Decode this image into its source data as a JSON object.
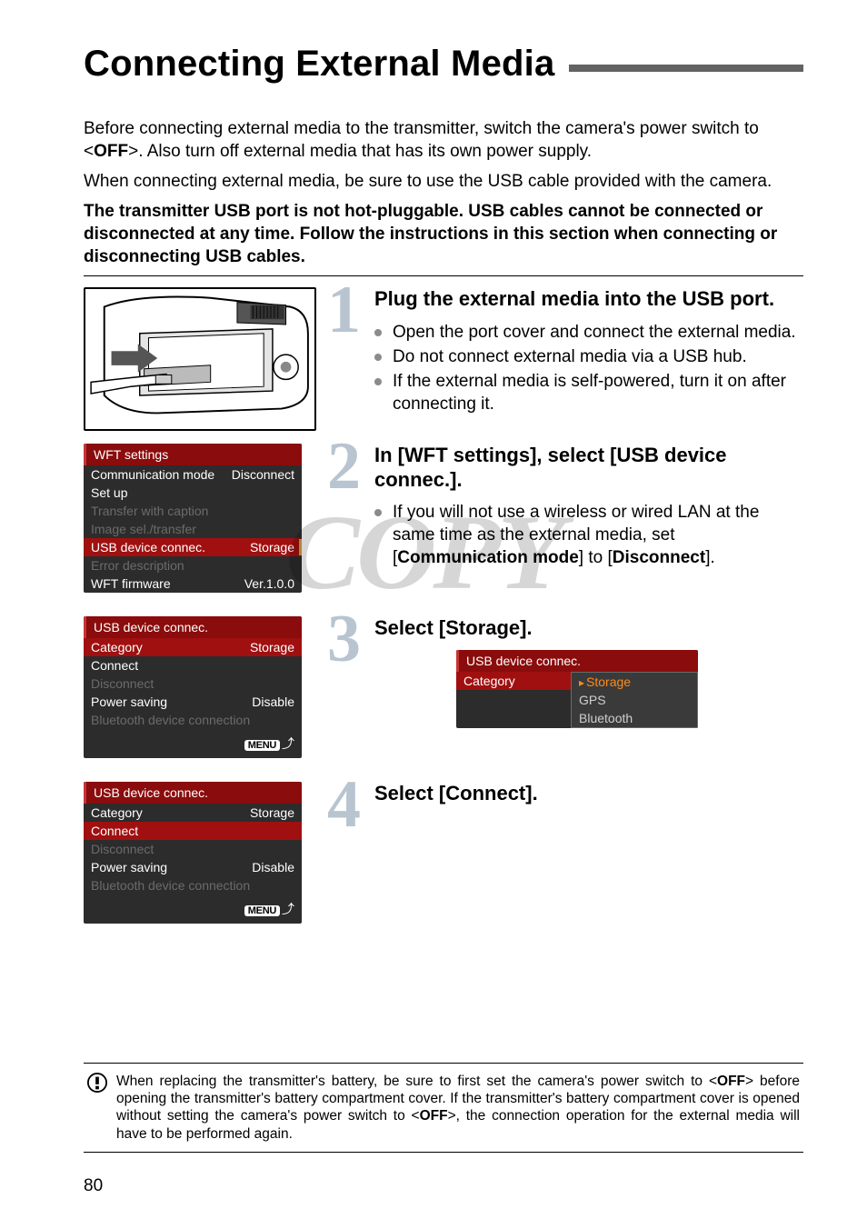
{
  "title": "Connecting External Media",
  "intro": {
    "p1a": "Before connecting external media to the transmitter, switch the camera's power switch to <",
    "p1_off": "OFF",
    "p1b": ">. Also turn off external media that has its own power supply.",
    "p2": "When connecting external media, be sure to use the USB cable provided with the camera.",
    "p3": "The transmitter USB port is not hot-pluggable. USB cables cannot be connected or disconnected at any time. Follow the instructions in this section when connecting or disconnecting USB cables."
  },
  "steps": {
    "s1": {
      "num": "1",
      "head": "Plug the external media into the USB port.",
      "bullets": [
        "Open the port cover and connect the external media.",
        "Do not connect external media via a USB hub.",
        "If the external media is self-powered, turn it on after connecting it."
      ]
    },
    "s2": {
      "num": "2",
      "head": "In [WFT settings], select [USB device connec.].",
      "bullet_a": "If you will not use a wireless or wired LAN at the same time as the external media, set [",
      "bullet_b": "Communication mode",
      "bullet_c": "] to [",
      "bullet_d": "Disconnect",
      "bullet_e": "]."
    },
    "s3": {
      "num": "3",
      "head": "Select [Storage]."
    },
    "s4": {
      "num": "4",
      "head": "Select [Connect]."
    }
  },
  "menu_wft": {
    "title": "WFT settings",
    "rows": [
      {
        "label": "Communication mode",
        "value": "Disconnect"
      },
      {
        "label": "Set up",
        "value": ""
      },
      {
        "label": "Transfer with caption",
        "value": ""
      },
      {
        "label": "Image sel./transfer",
        "value": ""
      },
      {
        "label": "USB device connec.",
        "value": "Storage"
      },
      {
        "label": "Error description",
        "value": ""
      },
      {
        "label": "WFT firmware",
        "value": "Ver.1.0.0"
      }
    ]
  },
  "menu_usb1": {
    "title": "USB device connec.",
    "rows": [
      {
        "label": "Category",
        "value": "Storage"
      },
      {
        "label": "Connect",
        "value": ""
      },
      {
        "label": "Disconnect",
        "value": ""
      },
      {
        "label": "Power saving",
        "value": "Disable"
      },
      {
        "label": "Bluetooth device connection",
        "value": ""
      }
    ],
    "footer": "MENU"
  },
  "menu_usb2": {
    "title": "USB device connec.",
    "rows": [
      {
        "label": "Category",
        "value": "Storage"
      },
      {
        "label": "Connect",
        "value": ""
      },
      {
        "label": "Disconnect",
        "value": ""
      },
      {
        "label": "Power saving",
        "value": "Disable"
      },
      {
        "label": "Bluetooth device connection",
        "value": ""
      }
    ],
    "footer": "MENU"
  },
  "menu_dd": {
    "title": "USB device connec.",
    "left_label": "Category",
    "options": [
      "Storage",
      "GPS",
      "Bluetooth"
    ]
  },
  "watermark": "COPY",
  "note": {
    "a": "When replacing the transmitter's battery, be sure to first set the camera's power switch to <",
    "off1": "OFF",
    "b": "> before opening the transmitter's battery compartment cover. If the transmitter's battery compartment cover is opened without setting the camera's power switch to <",
    "off2": "OFF",
    "c": ">, the connection operation for the external media will have to be performed again."
  },
  "page_number": "80"
}
